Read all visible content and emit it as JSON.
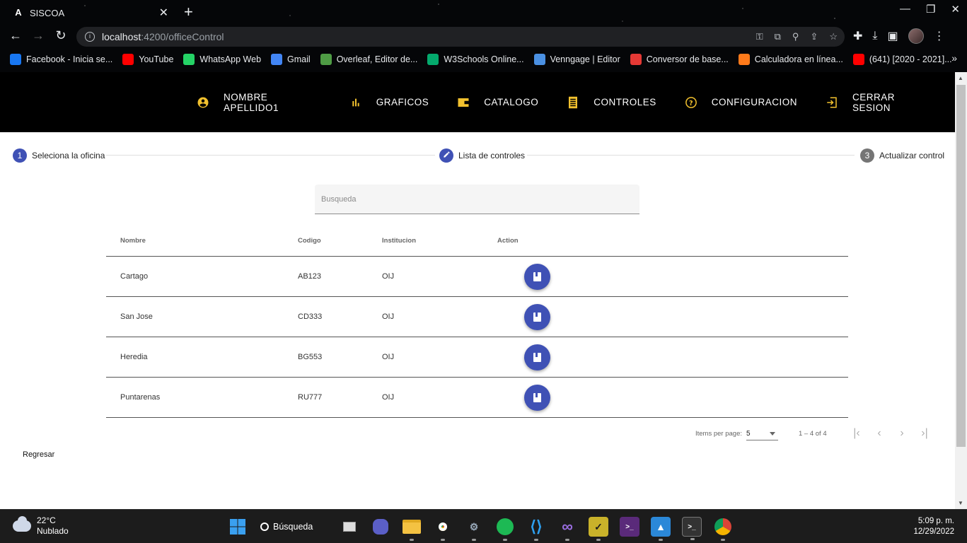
{
  "browser": {
    "tab_title": "SISCOA",
    "url_host": "localhost",
    "url_path": ":4200/officeControl",
    "bookmarks": [
      {
        "label": "Facebook - Inicia se...",
        "color": "#1877f2",
        "icon": "facebook-icon"
      },
      {
        "label": "YouTube",
        "color": "#ff0000",
        "icon": "youtube-icon"
      },
      {
        "label": "WhatsApp Web",
        "color": "#25d366",
        "icon": "whatsapp-icon"
      },
      {
        "label": "Gmail",
        "color": "#4285f4",
        "icon": "docs-icon"
      },
      {
        "label": "Overleaf, Editor de...",
        "color": "#4f9c45",
        "icon": "overleaf-icon"
      },
      {
        "label": "W3Schools Online...",
        "color": "#04aa6d",
        "icon": "w3schools-icon"
      },
      {
        "label": "Venngage | Editor",
        "color": "#4a90e2",
        "icon": "venngage-icon"
      },
      {
        "label": "Conversor de base...",
        "color": "#e53935",
        "icon": "tree-icon"
      },
      {
        "label": "Calculadora en línea...",
        "color": "#ff7a1a",
        "icon": "calculator-icon"
      },
      {
        "label": "(641) [2020 - 2021]...",
        "color": "#ff0000",
        "icon": "youtube-icon"
      }
    ]
  },
  "nav": {
    "items": [
      {
        "label": "NOMBRE APELLIDO1",
        "icon": "account-circle-icon"
      },
      {
        "label": "GRAFICOS",
        "icon": "bar-chart-icon"
      },
      {
        "label": "CATALOGO",
        "icon": "wallet-icon"
      },
      {
        "label": "CONTROLES",
        "icon": "list-icon"
      },
      {
        "label": "CONFIGURACION",
        "icon": "help-icon"
      },
      {
        "label": "CERRAR SESION",
        "icon": "logout-icon"
      }
    ],
    "accent": "#f2c12e"
  },
  "stepper": {
    "steps": [
      {
        "number": "1",
        "label": "Seleciona la oficina",
        "state": "done"
      },
      {
        "number": "",
        "label": "Lista de controles",
        "state": "edit"
      },
      {
        "number": "3",
        "label": "Actualizar control",
        "state": "pending"
      }
    ],
    "active_color": "#3f51b5"
  },
  "search": {
    "placeholder": "Busqueda",
    "value": ""
  },
  "table": {
    "headers": [
      "Nombre",
      "Codigo",
      "Institucion",
      "Action"
    ],
    "rows": [
      {
        "nombre": "Cartago",
        "codigo": "AB123",
        "institucion": "OIJ"
      },
      {
        "nombre": "San Jose",
        "codigo": "CD333",
        "institucion": "OIJ"
      },
      {
        "nombre": "Heredia",
        "codigo": "BG553",
        "institucion": "OIJ"
      },
      {
        "nombre": "Puntarenas",
        "codigo": "RU777",
        "institucion": "OIJ"
      }
    ]
  },
  "paginator": {
    "items_per_page_label": "Items per page:",
    "page_size": "5",
    "range": "1 – 4 of 4"
  },
  "back_link": "Regresar",
  "taskbar": {
    "temperature": "22°C",
    "weather": "Nublado",
    "search_label": "Búsqueda",
    "time": "5:09 p. m.",
    "date": "12/29/2022"
  }
}
